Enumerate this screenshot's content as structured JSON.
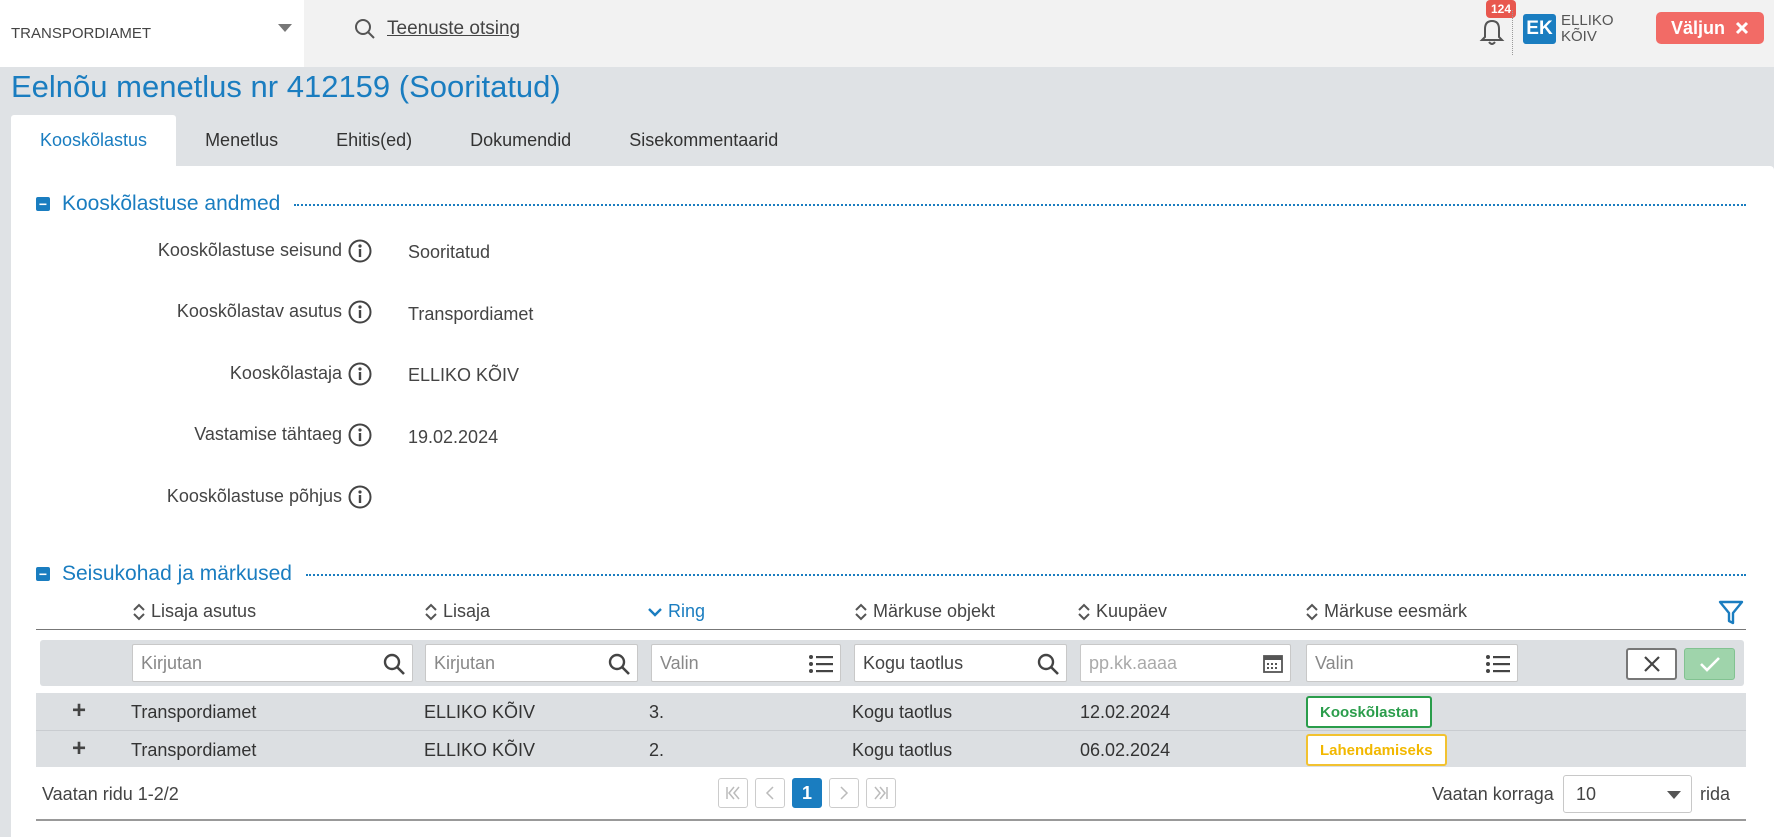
{
  "topbar": {
    "organization": "TRANSPORDIAMET",
    "search_label": "Teenuste otsing",
    "notification_count": "124",
    "user_initials": "EK",
    "user_first_name": "ELLIKO",
    "user_last_name": "KÕIV",
    "logout_label": "Väljun"
  },
  "page": {
    "title": "Eelnõu menetlus nr 412159 (Sooritatud)"
  },
  "tabs": [
    {
      "label": "Kooskõlastus",
      "active": true
    },
    {
      "label": "Menetlus"
    },
    {
      "label": "Ehitis(ed)"
    },
    {
      "label": "Dokumendid"
    },
    {
      "label": "Sisekommentaarid"
    }
  ],
  "details": {
    "title": "Kooskõlastuse andmed",
    "collapse_symbol": "−",
    "fields": [
      {
        "label": "Kooskõlastuse seisund",
        "value": "Sooritatud"
      },
      {
        "label": "Kooskõlastav asutus",
        "value": "Transpordiamet"
      },
      {
        "label": "Kooskõlastaja",
        "value": "ELLIKO KÕIV"
      },
      {
        "label": "Vastamise tähtaeg",
        "value": "19.02.2024"
      },
      {
        "label": "Kooskõlastuse põhjus",
        "value": ""
      }
    ]
  },
  "remarks": {
    "title": "Seisukohad ja märkused",
    "collapse_symbol": "−",
    "columns": [
      "Lisaja asutus",
      "Lisaja",
      "Ring",
      "Märkuse objekt",
      "Kuupäev",
      "Märkuse eesmärk"
    ],
    "sorted_column": "Ring",
    "filters": {
      "lisaja_asutus": "Kirjutan",
      "lisaja": "Kirjutan",
      "ring": "Valin",
      "objekt": "Kogu taotlus",
      "kuupaev": "pp.kk.aaaa",
      "eesmark": "Valin"
    },
    "expand_symbol": "+",
    "rows": [
      {
        "asutus": "Transpordiamet",
        "lisaja": "ELLIKO KÕIV",
        "ring": "3.",
        "objekt": "Kogu taotlus",
        "kuupaev": "12.02.2024",
        "eesmark": "Kooskõlastan",
        "status_color": "#2a9d4b"
      },
      {
        "asutus": "Transpordiamet",
        "lisaja": "ELLIKO KÕIV",
        "ring": "2.",
        "objekt": "Kogu taotlus",
        "kuupaev": "06.02.2024",
        "eesmark": "Lahendamiseks",
        "status_color": "#f2c230"
      }
    ]
  },
  "pagination": {
    "rows_info": "Vaatan ridu 1-2/2",
    "current_page": "1",
    "per_page_label": "Vaatan korraga",
    "per_page_value": "10",
    "per_page_suffix": "rida"
  },
  "colors": {
    "accent": "#1a7dc0",
    "logout": "#f26b66",
    "badge": "#e8574e"
  }
}
